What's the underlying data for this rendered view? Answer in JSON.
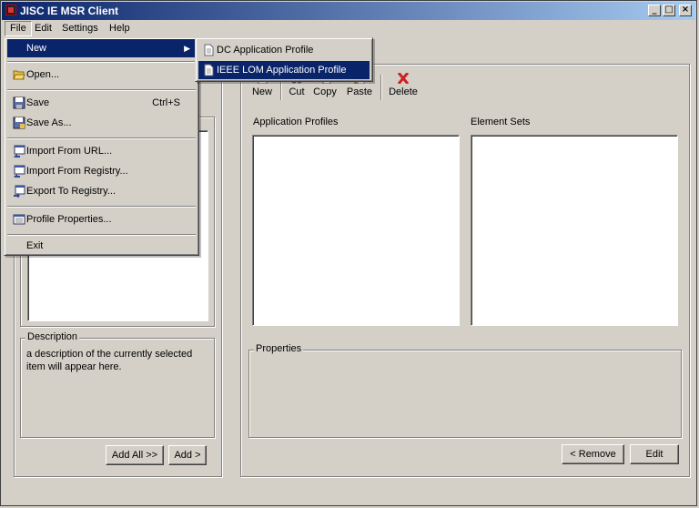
{
  "window": {
    "title": "JISC IE MSR Client"
  },
  "menubar": {
    "file": "File",
    "edit": "Edit",
    "settings": "Settings",
    "help": "Help"
  },
  "file_menu": {
    "new": "New",
    "open": "Open...",
    "save": "Save",
    "save_shortcut": "Ctrl+S",
    "save_as": "Save As...",
    "import_url": "Import From URL...",
    "import_registry": "Import From Registry...",
    "export_registry": "Export To Registry...",
    "profile_properties": "Profile Properties...",
    "exit": "Exit"
  },
  "new_submenu": {
    "dc": "DC Application Profile",
    "ieee": "IEEE LOM Application Profile"
  },
  "toolbar": {
    "new": "New",
    "cut": "Cut",
    "copy": "Copy",
    "paste": "Paste",
    "delete": "Delete"
  },
  "left_panel": {
    "description_label": "Description",
    "description_text": "a description of the currently selected item will appear here.",
    "add_all": "Add All >>",
    "add": "Add >"
  },
  "right_panel": {
    "application_profiles_label": "Application Profiles",
    "element_sets_label": "Element Sets",
    "properties_label": "Properties",
    "remove": "< Remove",
    "edit": "Edit"
  },
  "icons": {
    "app": "app-logo-icon",
    "delete": "red-x-icon",
    "document": "document-icon",
    "folder": "folder-open-icon",
    "save": "floppy-disk-icon"
  },
  "colors": {
    "title_start": "#0a246a",
    "title_end": "#a6caf0",
    "highlight": "#0a246a",
    "delete_red": "#cc2222",
    "face": "#d4d0c8"
  }
}
